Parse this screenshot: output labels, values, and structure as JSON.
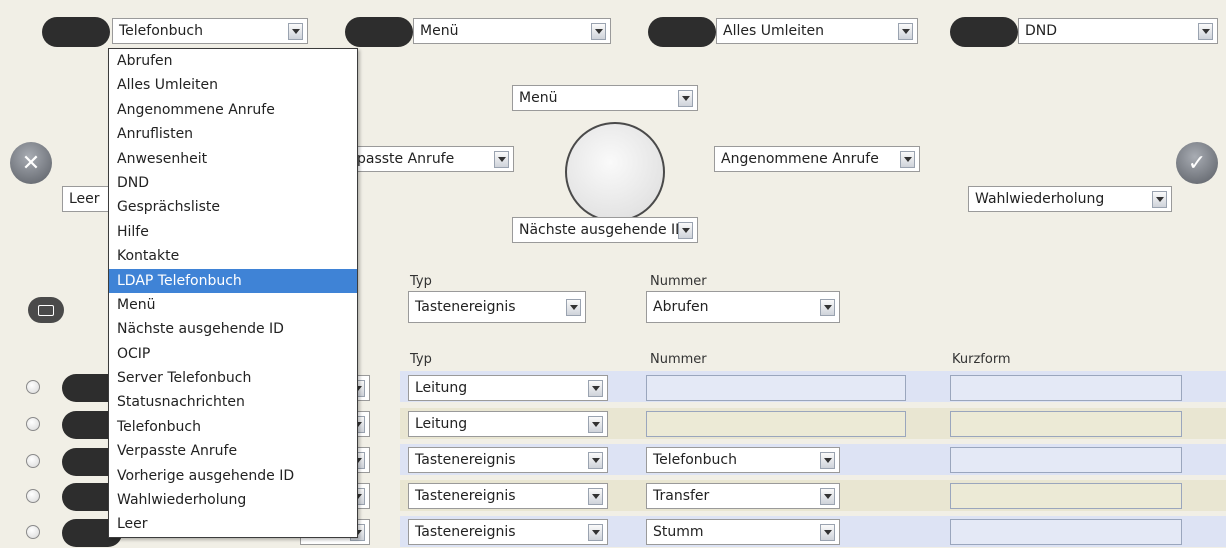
{
  "top_keys": [
    {
      "value": "Telefonbuch"
    },
    {
      "value": "Menü"
    },
    {
      "value": "Alles Umleiten"
    },
    {
      "value": "DND"
    }
  ],
  "nav": {
    "top": "Menü",
    "left": "Verpasste Anrufe",
    "left_visible": "passte Anrufe",
    "right": "Angenommene Anrufe",
    "bottom": "Nächste ausgehende ID",
    "ok_side": "Wahlwiederholung",
    "cancel_side": "Leer"
  },
  "message_key": {
    "typ_label": "Typ",
    "typ_value": "Tastenereignis",
    "nummer_label": "Nummer",
    "nummer_value": "Abrufen"
  },
  "table": {
    "headers": {
      "typ": "Typ",
      "nummer": "Nummer",
      "kurzform": "Kurzform"
    },
    "rows": [
      {
        "typ": "Leitung",
        "nummer": "",
        "kurzform": ""
      },
      {
        "typ": "Leitung",
        "nummer": "",
        "kurzform": ""
      },
      {
        "typ": "Tastenereignis",
        "nummer": "Telefonbuch",
        "kurzform": ""
      },
      {
        "typ": "Tastenereignis",
        "nummer": "Transfer",
        "kurzform": ""
      },
      {
        "typ": "Tastenereignis",
        "nummer": "Stumm",
        "kurzform": ""
      }
    ]
  },
  "dropdown": {
    "items": [
      "Abrufen",
      "Alles Umleiten",
      "Angenommene Anrufe",
      "Anruflisten",
      "Anwesenheit",
      "DND",
      "Gesprächsliste",
      "Hilfe",
      "Kontakte",
      "LDAP Telefonbuch",
      "Menü",
      "Nächste ausgehende ID",
      "OCIP",
      "Server Telefonbuch",
      "Statusnachrichten",
      "Telefonbuch",
      "Verpasste Anrufe",
      "Vorherige ausgehende ID",
      "Wahlwiederholung",
      "Leer"
    ],
    "highlighted_index": 9
  },
  "colors": {
    "accent": "#3f83d6",
    "row_blue": "#dde3f4",
    "row_tan": "#e9e6d2",
    "field_blue": "#e4e9f6",
    "field_tan": "#ecead6"
  }
}
